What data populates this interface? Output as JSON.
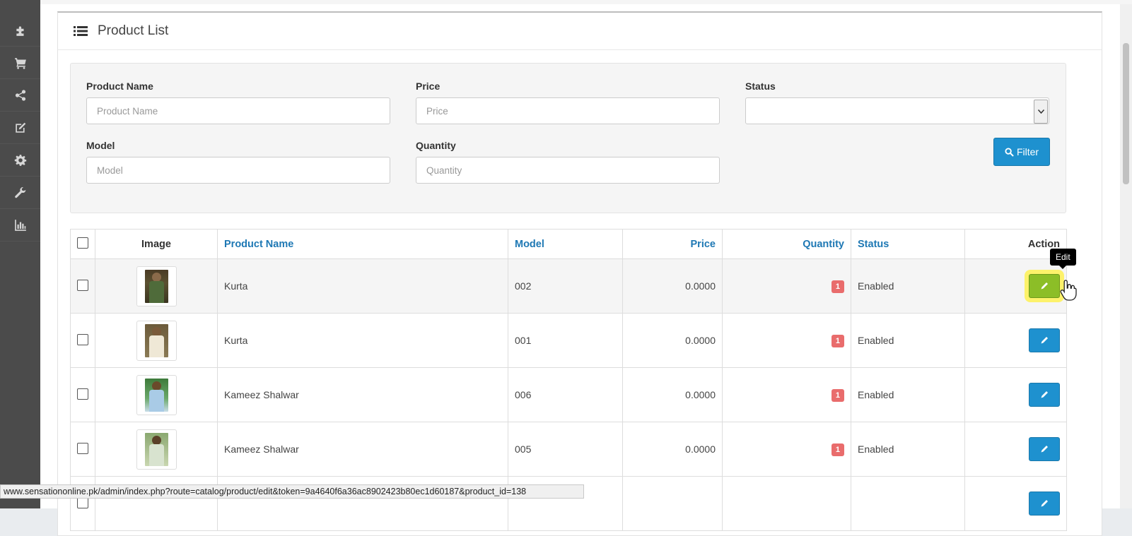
{
  "sidebar": {
    "items": [
      {
        "icon": "puzzle-icon"
      },
      {
        "icon": "cart-icon"
      },
      {
        "icon": "share-icon"
      },
      {
        "icon": "edit-icon"
      },
      {
        "icon": "gear-icon"
      },
      {
        "icon": "wrench-icon"
      },
      {
        "icon": "bar-chart-icon"
      }
    ]
  },
  "panel": {
    "title": "Product List"
  },
  "filter": {
    "product_name": {
      "label": "Product Name",
      "placeholder": "Product Name",
      "value": ""
    },
    "price": {
      "label": "Price",
      "placeholder": "Price",
      "value": ""
    },
    "status": {
      "label": "Status",
      "value": ""
    },
    "model": {
      "label": "Model",
      "placeholder": "Model",
      "value": ""
    },
    "quantity": {
      "label": "Quantity",
      "placeholder": "Quantity",
      "value": ""
    },
    "button_label": "Filter"
  },
  "table": {
    "headers": {
      "image": "Image",
      "product_name": "Product Name",
      "model": "Model",
      "price": "Price",
      "quantity": "Quantity",
      "status": "Status",
      "action": "Action"
    },
    "rows": [
      {
        "name": "Kurta",
        "model": "002",
        "price": "0.0000",
        "quantity": "1",
        "status": "Enabled"
      },
      {
        "name": "Kurta",
        "model": "001",
        "price": "0.0000",
        "quantity": "1",
        "status": "Enabled"
      },
      {
        "name": "Kameez Shalwar",
        "model": "006",
        "price": "0.0000",
        "quantity": "1",
        "status": "Enabled"
      },
      {
        "name": "Kameez Shalwar",
        "model": "005",
        "price": "0.0000",
        "quantity": "1",
        "status": "Enabled"
      }
    ]
  },
  "tooltip": {
    "text": "Edit"
  },
  "statusbar": {
    "url": "www.sensationonline.pk/admin/index.php?route=catalog/product/edit&token=9a4640f6a36ac8902423b80ec1d60187&product_id=138"
  },
  "colors": {
    "accent": "#1e91cf",
    "badge": "#e96c6c",
    "sidebar": "#4b4b4b",
    "active_button": "#8cbe27"
  }
}
